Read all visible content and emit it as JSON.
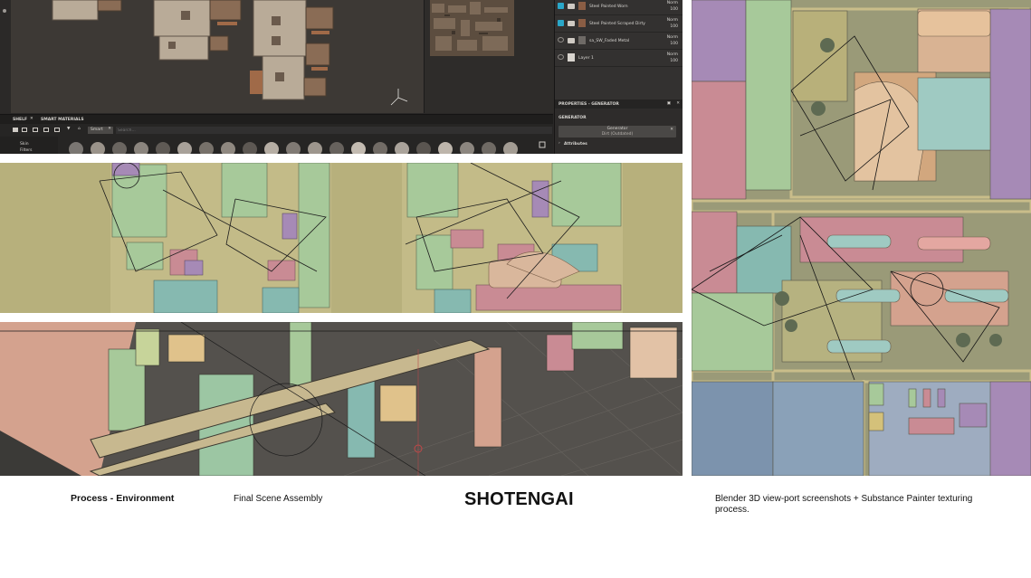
{
  "captions": {
    "section": "Process - Environment",
    "subtitle": "Final Scene Assembly",
    "project_title": "SHOTENGAI",
    "description": "Blender 3D view-port screenshots + Substance Painter texturing process."
  },
  "substance_painter": {
    "layers": [
      {
        "name": "Steel Painted Worn",
        "blend": "Norm",
        "opacity": "100",
        "visible": true
      },
      {
        "name": "Steel Painted Scraped Dirty",
        "blend": "Norm",
        "opacity": "100",
        "visible": true
      },
      {
        "name": "sa_SW_Faded Metal",
        "blend": "Norm",
        "opacity": "100",
        "visible": false
      },
      {
        "name": "Layer 1",
        "blend": "Norm",
        "opacity": "100",
        "visible": false
      }
    ],
    "properties_panel": {
      "title": "PROPERTIES - GENERATOR",
      "section": "GENERATOR",
      "generator_label": "Generator",
      "generator_value": "Dirt (Outdated)",
      "attributes_label": "Attributes"
    },
    "shelf": {
      "tabs": [
        "SHELF",
        "SMART MATERIALS"
      ],
      "search_chip": "Smart",
      "search_placeholder": "Search...",
      "categories": [
        "Skin",
        "Filters"
      ]
    }
  },
  "colors": {
    "painter_bg": "#2a2827",
    "accent_eye": "#2aa7c9",
    "uv_base": "#b7b07c",
    "uv_green": "#a7c99a",
    "uv_pink": "#c98b94",
    "uv_teal": "#86b9b0",
    "uv_purple": "#a68ab6",
    "uv_blue": "#7c93ad",
    "scene_floor": "#54514d"
  }
}
